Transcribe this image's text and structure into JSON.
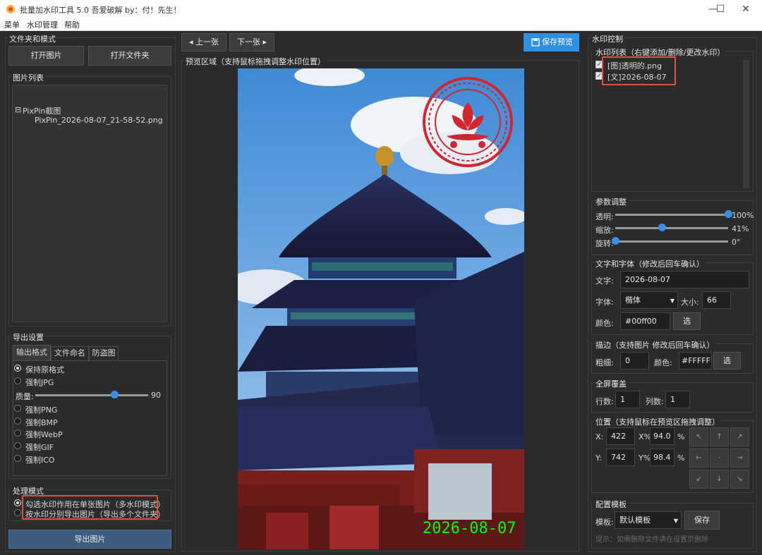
{
  "window": {
    "title": "批量加水印工具 5.0    吾爱破解 by：付！先生！",
    "min": "—",
    "max": "☐",
    "close": "✕"
  },
  "menu": [
    "菜单",
    "水印管理",
    "帮助"
  ],
  "left": {
    "files_group": "文件夹和模式",
    "open_image": "打开图片",
    "open_folder": "打开文件夹",
    "image_list_group": "图片列表",
    "tree_folder": "PixPin截图",
    "tree_file": "PixPin_2026-08-07_21-58-52.png",
    "tree_toggle": "⊟",
    "export_group": "导出设置",
    "tabs": [
      "输出格式",
      "文件命名",
      "防盗图"
    ],
    "format_options": [
      "保持原格式",
      "强制JPG"
    ],
    "quality_label": "质量:",
    "quality_value": "90",
    "format_options2": [
      "强制PNG",
      "强制BMP",
      "强制WebP",
      "强制GIF",
      "强制ICO"
    ],
    "mode_group": "处理模式",
    "modes": [
      "勾选水印作用在单张图片（多水印模式）",
      "按水印分别导出图片（导出多个文件夹）"
    ],
    "export_button": "导出图片"
  },
  "center": {
    "prev": "◂ 上一张",
    "next": "下一张 ▸",
    "save_preview": "保存预览",
    "preview_group": "预览区域（支持鼠标拖拽调整水印位置）",
    "watermark_text": "2026-08-07",
    "watermark_color": "#00ff00"
  },
  "right": {
    "control_group": "水印控制",
    "list_group": "水印列表（右键添加/删除/更改水印）",
    "watermarks": [
      "[图]透明的.png",
      "[文]2026-08-07"
    ],
    "params_group": "参数调整",
    "opacity_label": "透明:",
    "opacity_value": "100%",
    "opacity": 1.0,
    "scale_label": "缩放:",
    "scale_value": "41%",
    "scale": 0.41,
    "rotate_label": "旋转:",
    "rotate_value": "0°",
    "rotate": 0,
    "text_group": "文字和字体（修改后回车确认）",
    "text_label": "文字:",
    "text_value": "2026-08-07",
    "font_label": "字体:",
    "font_value": "楷体",
    "size_label": "大小:",
    "size_value": "66",
    "color_label": "颜色:",
    "color_value": "#00ff00",
    "pick": "选",
    "stroke_group": "描边（支持图片 修改后回车确认）",
    "thick_label": "粗细:",
    "thick_value": "0",
    "stroke_color_label": "颜色:",
    "stroke_color_value": "#FFFFFF",
    "tile_group": "全屏覆盖",
    "rows_label": "行数:",
    "rows_value": "1",
    "cols_label": "列数:",
    "cols_value": "1",
    "pos_group": "位置（支持鼠标在预览区拖拽调整）",
    "x_label": "X:",
    "x_value": "422",
    "xp_label": "X%",
    "xp_value": "94.0",
    "y_label": "Y:",
    "y_value": "742",
    "yp_label": "Y%",
    "yp_value": "98.4",
    "percent": "%",
    "template_group": "配置模板",
    "template_label": "模板:",
    "template_value": "默认模板",
    "save": "保存",
    "hint": "提示：如需删除文件请在设置页删除"
  },
  "colors": {
    "accent": "#3a8ee6",
    "highlight": "#e0523a",
    "watermark": "#00ff00"
  }
}
